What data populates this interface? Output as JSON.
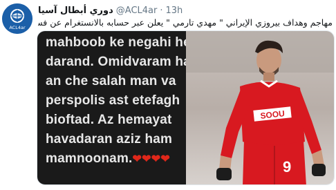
{
  "account": {
    "display_name": "دوري أبطال آسيا",
    "handle": "@ACL4ar",
    "time": "13h",
    "avatar_label": "ACL4ar"
  },
  "tweet": {
    "text": "مهاجم وهداف بيروزي الإيراني \" مهدي تارمي \" يعلن عبر حسابه بالانستغرام عن فسخ عقده مع بيروزي ."
  },
  "story": {
    "lines": [
      "mahboob ke negahi herfei",
      "darand. Omidvaram har",
      "an che salah man va",
      "perspolis ast etefagh",
      "bioftad. Az hemayat",
      "havadaran aziz ham",
      "mamnoonam."
    ],
    "hearts": "❤❤❤❤"
  },
  "photo": {
    "jersey_number": "9",
    "sponsor_text": "SOOU"
  },
  "colors": {
    "text": "#14171a",
    "muted": "#657786",
    "jersey": "#d81920",
    "heart": "#e0271a"
  }
}
